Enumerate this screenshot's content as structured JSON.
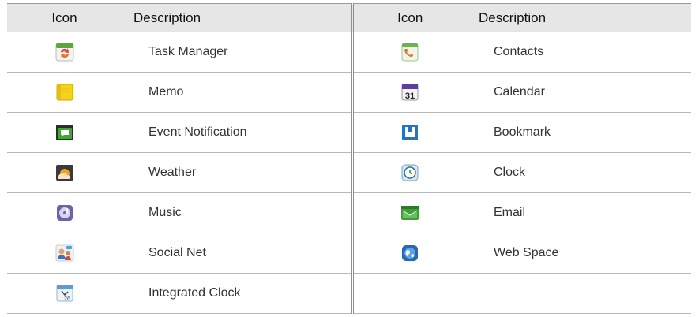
{
  "headers": {
    "left_icon": "Icon",
    "left_desc": "Description",
    "right_icon": "Icon",
    "right_desc": "Description"
  },
  "left": [
    {
      "icon": "task-manager-icon",
      "label": "Task Manager"
    },
    {
      "icon": "memo-icon",
      "label": "Memo"
    },
    {
      "icon": "event-notification-icon",
      "label": "Event Notification"
    },
    {
      "icon": "weather-icon",
      "label": "Weather"
    },
    {
      "icon": "music-icon",
      "label": "Music"
    },
    {
      "icon": "social-net-icon",
      "label": "Social Net"
    },
    {
      "icon": "integrated-clock-icon",
      "label": "Integrated Clock"
    }
  ],
  "right": [
    {
      "icon": "contacts-icon",
      "label": "Contacts"
    },
    {
      "icon": "calendar-icon",
      "label": "Calendar",
      "badge": "31"
    },
    {
      "icon": "bookmark-icon",
      "label": "Bookmark"
    },
    {
      "icon": "clock-icon",
      "label": "Clock"
    },
    {
      "icon": "email-icon",
      "label": "Email"
    },
    {
      "icon": "web-space-icon",
      "label": "Web Space"
    }
  ],
  "integrated_clock_badge": "26"
}
